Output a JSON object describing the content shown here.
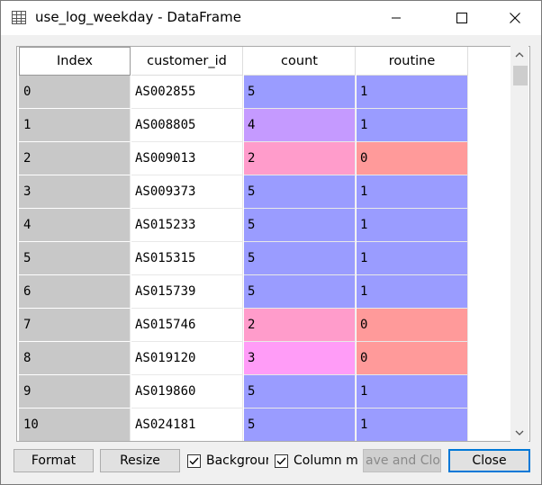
{
  "window": {
    "title": "use_log_weekday - DataFrame",
    "icon": "table-grid-icon"
  },
  "columns": [
    "Index",
    "customer_id",
    "count",
    "routine"
  ],
  "rows": [
    {
      "index": "0",
      "customer_id": "AS002855",
      "count": "5",
      "routine": "1",
      "count_color": "#9a9cff",
      "routine_color": "#9a9cff"
    },
    {
      "index": "1",
      "customer_id": "AS008805",
      "count": "4",
      "routine": "1",
      "count_color": "#c59aff",
      "routine_color": "#9a9cff"
    },
    {
      "index": "2",
      "customer_id": "AS009013",
      "count": "2",
      "routine": "0",
      "count_color": "#ff9ccb",
      "routine_color": "#ff9a9a"
    },
    {
      "index": "3",
      "customer_id": "AS009373",
      "count": "5",
      "routine": "1",
      "count_color": "#9a9cff",
      "routine_color": "#9a9cff"
    },
    {
      "index": "4",
      "customer_id": "AS015233",
      "count": "5",
      "routine": "1",
      "count_color": "#9a9cff",
      "routine_color": "#9a9cff"
    },
    {
      "index": "5",
      "customer_id": "AS015315",
      "count": "5",
      "routine": "1",
      "count_color": "#9a9cff",
      "routine_color": "#9a9cff"
    },
    {
      "index": "6",
      "customer_id": "AS015739",
      "count": "5",
      "routine": "1",
      "count_color": "#9a9cff",
      "routine_color": "#9a9cff"
    },
    {
      "index": "7",
      "customer_id": "AS015746",
      "count": "2",
      "routine": "0",
      "count_color": "#ff9ccb",
      "routine_color": "#ff9a9a"
    },
    {
      "index": "8",
      "customer_id": "AS019120",
      "count": "3",
      "routine": "0",
      "count_color": "#ff9cf7",
      "routine_color": "#ff9a9a"
    },
    {
      "index": "9",
      "customer_id": "AS019860",
      "count": "5",
      "routine": "1",
      "count_color": "#9a9cff",
      "routine_color": "#9a9cff"
    },
    {
      "index": "10",
      "customer_id": "AS024181",
      "count": "5",
      "routine": "1",
      "count_color": "#9a9cff",
      "routine_color": "#9a9cff"
    }
  ],
  "buttons": {
    "format": "Format",
    "resize": "Resize",
    "background": "Backgrour",
    "column_min": "Column mi",
    "save_close": "ave and Clos",
    "close": "Close"
  },
  "checkboxes": {
    "background_checked": true,
    "column_min_checked": true
  },
  "colors": {
    "index_bg": "#c8c8c8",
    "accent": "#0078d7"
  }
}
